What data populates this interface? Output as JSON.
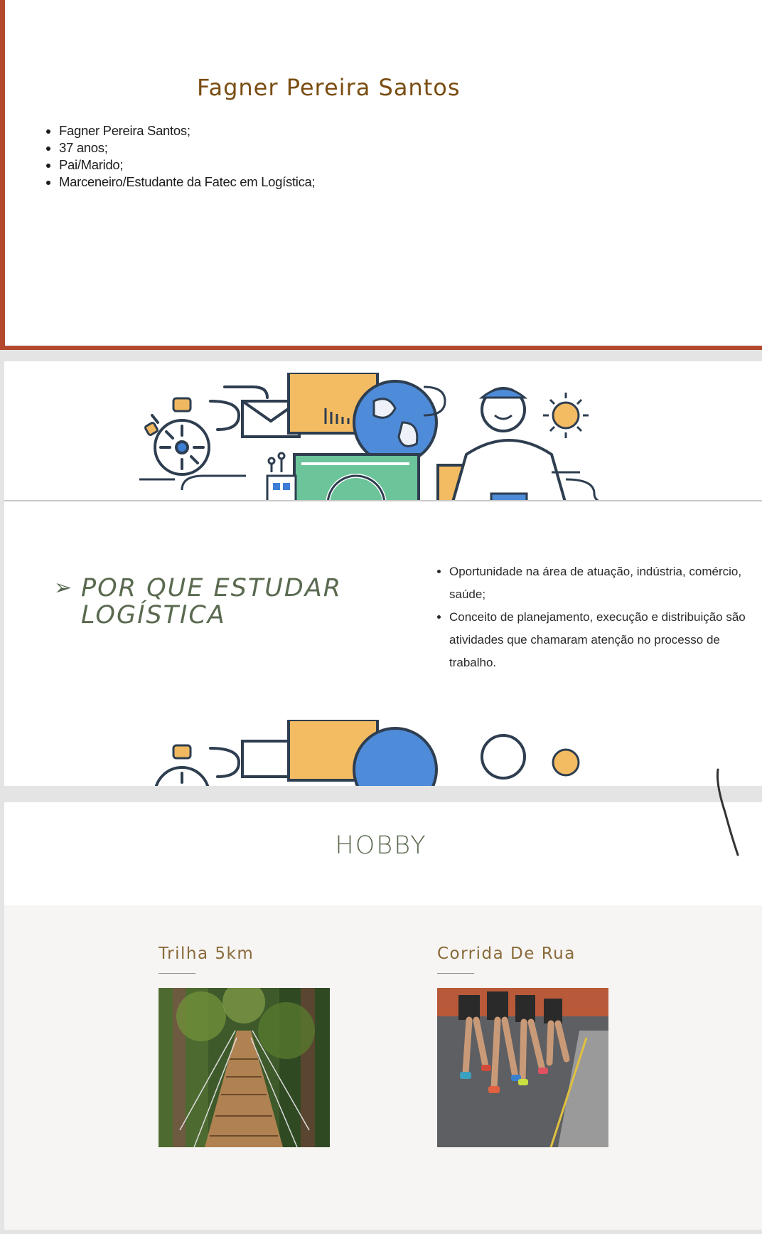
{
  "slide1": {
    "title": "Fagner Pereira Santos",
    "bullets": [
      "Fagner Pereira Santos;",
      "37 anos;",
      "Pai/Marido;",
      "Marceneiro/Estudante da Fatec em Logística;"
    ],
    "accent_color": "#b3482c"
  },
  "slide2": {
    "arrow_icon": "arrowhead-bullet-icon",
    "heading_line1": "POR QUE ESTUDAR",
    "heading_line2": "LOGÍSTICA",
    "bullets": [
      "Oportunidade na área de atuação, indústria, comércio, saúde;",
      "Conceito de planejamento, execução e distribuição são atividades que chamaram atenção no processo de trabalho."
    ]
  },
  "slide3": {
    "title": "HOBBY",
    "cards": [
      {
        "label": "Trilha 5km",
        "image": "rope-bridge-forest-photo"
      },
      {
        "label": "Corrida De Rua",
        "image": "street-race-runners-photo"
      }
    ]
  }
}
